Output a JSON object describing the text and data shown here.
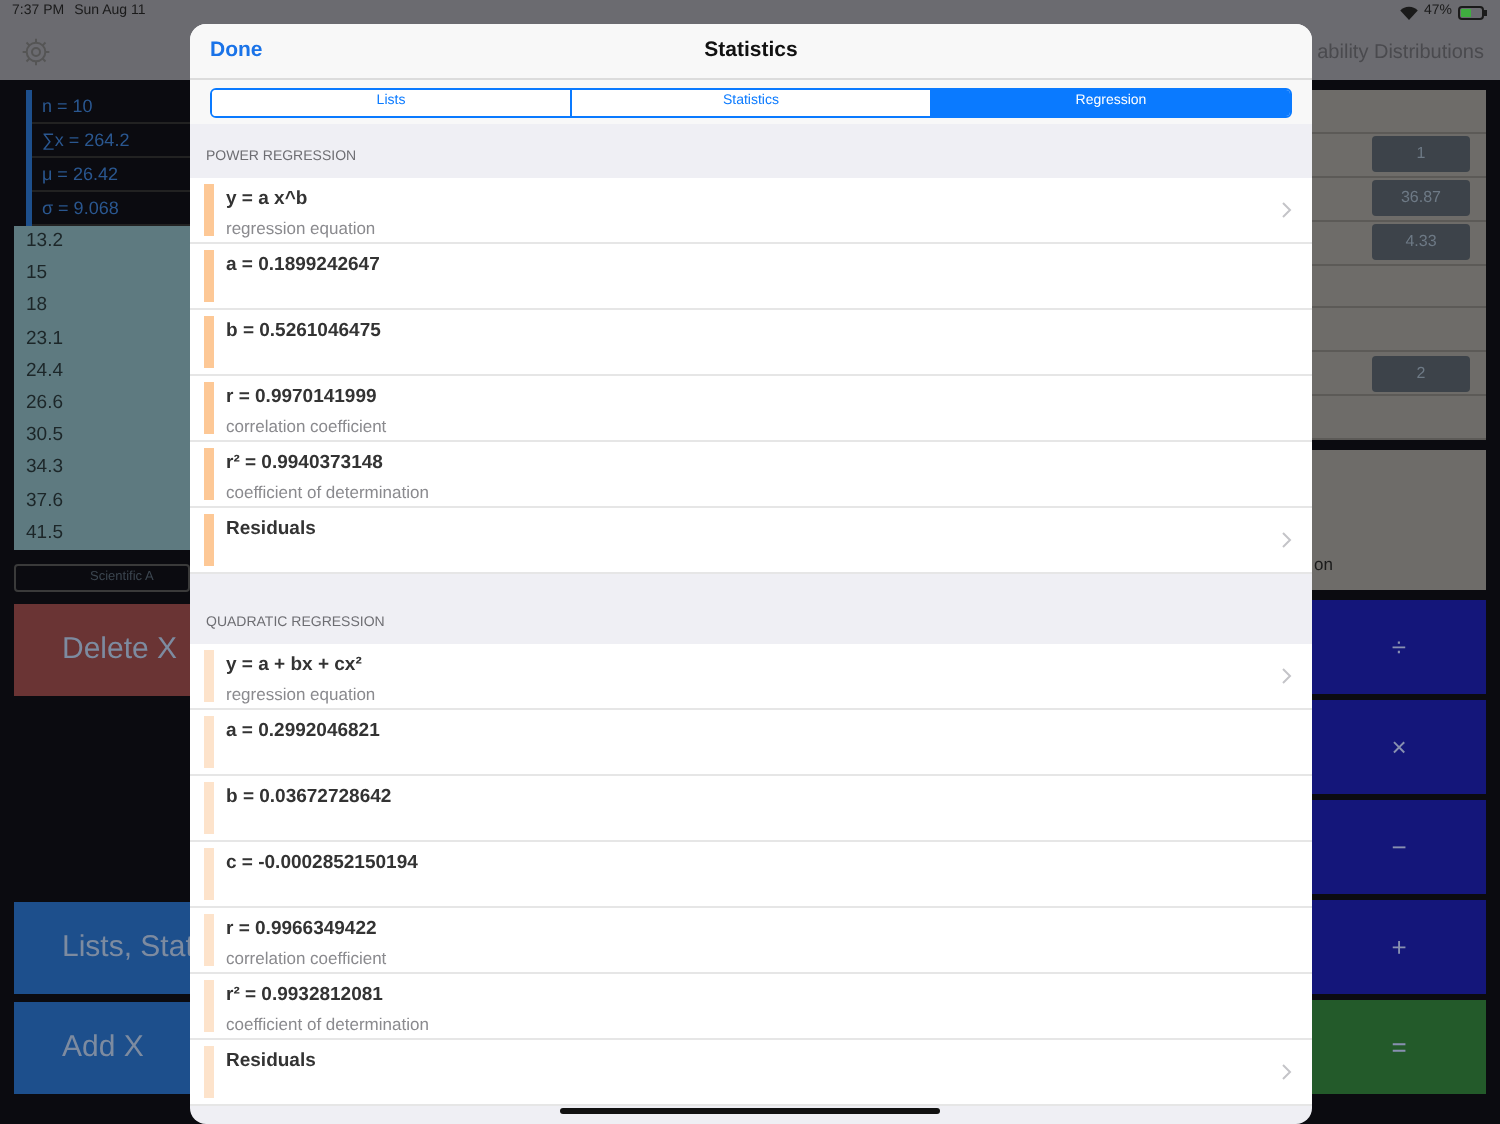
{
  "status_bar": {
    "time": "7:37 PM",
    "date": "Sun Aug 11",
    "battery": "47%"
  },
  "background": {
    "top_bar_title": "ability Distributions",
    "summary": [
      "n = 10",
      "∑x = 264.2",
      "μ = 26.42",
      "σ = 9.068"
    ],
    "values": [
      "13.2",
      "15",
      "18",
      "23.1",
      "24.4",
      "26.6",
      "30.5",
      "34.3",
      "37.6",
      "41.5"
    ],
    "mode_button": "Scientific A",
    "left_buttons": [
      {
        "label": "Delete X",
        "kind": "delete"
      },
      {
        "label": "Lists, Stat",
        "kind": "action"
      },
      {
        "label": "Add X",
        "kind": "action"
      }
    ],
    "panel_rows": [
      {},
      {
        "value": "1"
      },
      {
        "value": "36.87"
      },
      {
        "value": "4.33"
      },
      {},
      {},
      {
        "value": "2"
      },
      {}
    ],
    "panel_label": "on",
    "operators": [
      {
        "label": "÷",
        "kind": "operator"
      },
      {
        "label": "×",
        "kind": "operator"
      },
      {
        "label": "−",
        "kind": "operator"
      },
      {
        "label": "+",
        "kind": "operator"
      },
      {
        "label": "=",
        "kind": "equals"
      }
    ]
  },
  "modal": {
    "done": "Done",
    "title": "Statistics",
    "tabs": [
      {
        "label": "Lists",
        "selected": false
      },
      {
        "label": "Statistics",
        "selected": false
      },
      {
        "label": "Regression",
        "selected": true
      }
    ],
    "sections": [
      {
        "title": "POWER REGRESSION",
        "rows": [
          {
            "title": "y = a x^b",
            "subtitle": "regression equation",
            "disclosure": true,
            "color": "#fdc896"
          },
          {
            "title": "a = 0.1899242647",
            "disclosure": false,
            "color": "#fdc896"
          },
          {
            "title": "b = 0.5261046475",
            "disclosure": false,
            "color": "#fdc896"
          },
          {
            "title": "r = 0.9970141999",
            "subtitle": "correlation coefficient",
            "disclosure": false,
            "color": "#fdc896"
          },
          {
            "title": "r² = 0.9940373148",
            "subtitle": "coefficient of determination",
            "disclosure": false,
            "color": "#fdc896"
          },
          {
            "title": "Residuals",
            "disclosure": true,
            "color": "#fdc896"
          }
        ]
      },
      {
        "title": "QUADRATIC REGRESSION",
        "rows": [
          {
            "title": "y = a + bx + cx²",
            "subtitle": "regression equation",
            "disclosure": true,
            "color": "#fde3cb"
          },
          {
            "title": "a = 0.2992046821",
            "disclosure": false,
            "color": "#fde3cb"
          },
          {
            "title": "b = 0.03672728642",
            "disclosure": false,
            "color": "#fde3cb"
          },
          {
            "title": "c = -0.0002852150194",
            "disclosure": false,
            "color": "#fde3cb"
          },
          {
            "title": "r = 0.9966349422",
            "subtitle": "correlation coefficient",
            "disclosure": false,
            "color": "#fde3cb"
          },
          {
            "title": "r² = 0.9932812081",
            "subtitle": "coefficient of determination",
            "disclosure": false,
            "color": "#fde3cb"
          },
          {
            "title": "Residuals",
            "disclosure": true,
            "color": "#fde3cb"
          }
        ]
      }
    ]
  }
}
